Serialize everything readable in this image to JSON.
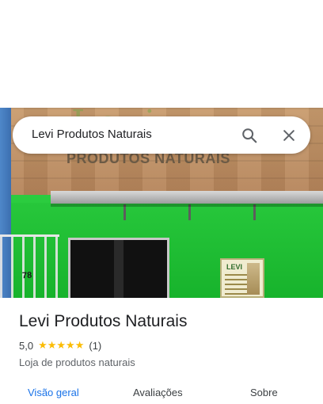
{
  "search": {
    "query": "Levi Produtos Naturais",
    "search_icon": "search-icon",
    "close_icon": "close-icon"
  },
  "photo": {
    "sign_text": "PRODUTOS NATURAIS",
    "logo_text": "Levi",
    "poster_title": "LEVI",
    "door_number": "78"
  },
  "place": {
    "name": "Levi Produtos Naturais",
    "rating": "5,0",
    "stars": "★★★★★",
    "review_count": "(1)",
    "category": "Loja de produtos naturais"
  },
  "tabs": [
    {
      "label": "Visão geral",
      "active": true
    },
    {
      "label": "Avaliações",
      "active": false
    },
    {
      "label": "Sobre",
      "active": false
    }
  ],
  "colors": {
    "accent": "#1a73e8",
    "star": "#fbbc04",
    "text": "#202124",
    "secondary": "#5f6368"
  }
}
